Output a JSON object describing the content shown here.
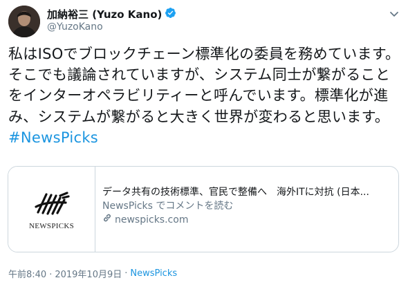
{
  "tweet": {
    "author": {
      "display_name": "加納裕三 (Yuzo Kano)",
      "handle": "@YuzoKano",
      "verified": true,
      "verified_color": "#1da1f2"
    },
    "text": "私はISOでブロックチェーン標準化の委員を務めています。そこでも議論されていますが、システム同士が繋がることをインターオペラビリティーと呼んでいます。標準化が進み、システムが繋がると大きく世界が変わると思います。",
    "hashtag": "#NewsPicks",
    "card": {
      "logo_text": "NEWSPICKS",
      "title": "データ共有の技術標準、官民で整備へ　海外ITに対抗 (日本...",
      "description": "NewsPicks でコメントを読む",
      "domain": "newspicks.com"
    },
    "meta": {
      "time": "午前8:40",
      "date": "2019年10月9日",
      "separator": "·",
      "source": "NewsPicks"
    },
    "colors": {
      "link": "#1b95e0",
      "secondary_text": "#657786",
      "border": "#ccd6dd"
    }
  }
}
